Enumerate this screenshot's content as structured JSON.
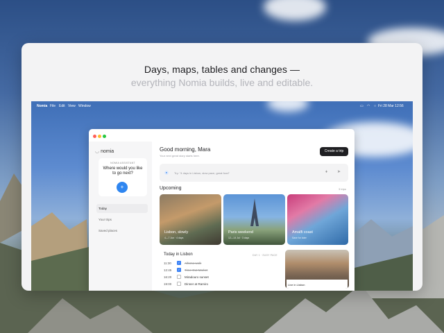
{
  "headline": "Days, maps, tables and changes —",
  "subline": "everything Nomia builds, live and editable.",
  "menubar": {
    "app": "Nomia",
    "items": [
      "File",
      "Edit",
      "View",
      "Window"
    ],
    "clock": "Fri 28 Mar 12:56"
  },
  "sidebar": {
    "brand": "nomia",
    "assistant_label": "NOMIA ASSISTANT",
    "assistant_prompt": "Where would you like to go next?",
    "nav": [
      "Today",
      "Your trips",
      "Saved places"
    ]
  },
  "main": {
    "greeting": "Good morning, Mara",
    "subgreeting": "Your next great story starts here.",
    "create_button": "Create a trip",
    "search_placeholder": "Try: \"4 days in Lisbon, slow pace, great food\"",
    "upcoming_title": "Upcoming",
    "upcoming_count": "3 trips",
    "trips": [
      {
        "title": "Lisbon, slowly",
        "meta": "4—7 Jun · 4 days"
      },
      {
        "title": "Paris weekend",
        "meta": "12—14 Jul · 3 days"
      },
      {
        "title": "Amalfi coast",
        "meta": "Save for later"
      }
    ],
    "today_title": "Today in Lisbon",
    "today_tag": "DAY 1 · EASY PACE",
    "schedule": [
      {
        "time": "11:30",
        "item": "Alfama walk",
        "done": true
      },
      {
        "time": "12:45",
        "item": "Time Out Market",
        "done": true
      },
      {
        "time": "16:20",
        "item": "Miradouro sunset",
        "done": false
      },
      {
        "time": "19:00",
        "item": "Dinner at Ramiro",
        "done": false
      }
    ],
    "live_label": "Live in Lisbon"
  }
}
